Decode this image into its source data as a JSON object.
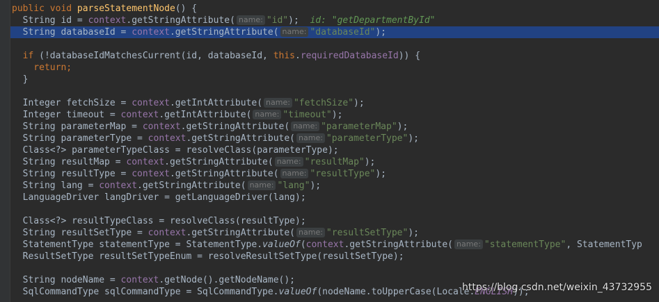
{
  "editor": {
    "lines": [
      {
        "tokens": [
          {
            "t": "public void ",
            "c": "kw"
          },
          {
            "t": "parseStatementNode",
            "c": "fn"
          },
          {
            "t": "() {",
            "c": ""
          }
        ]
      },
      {
        "tokens": [
          {
            "t": "  String id = ",
            "c": ""
          },
          {
            "t": "context",
            "c": "fld"
          },
          {
            "t": ".getStringAttribute(",
            "c": ""
          },
          {
            "t": "name:",
            "c": "hint"
          },
          {
            "t": "\"id\"",
            "c": "str"
          },
          {
            "t": ");  ",
            "c": ""
          },
          {
            "t": "id: \"getDepartmentById\"",
            "c": "inlay-comment"
          }
        ]
      },
      {
        "selected": true,
        "tokens": [
          {
            "t": "  String databaseId = ",
            "c": ""
          },
          {
            "t": "context",
            "c": "fld"
          },
          {
            "t": ".getStringAttribute(",
            "c": ""
          },
          {
            "t": "name:",
            "c": "hint"
          },
          {
            "t": "\"databaseId\"",
            "c": "str"
          },
          {
            "t": ");",
            "c": ""
          }
        ]
      },
      {
        "tokens": []
      },
      {
        "tokens": [
          {
            "t": "  if ",
            "c": "kw"
          },
          {
            "t": "(!databaseIdMatchesCurrent(id, databaseId, ",
            "c": ""
          },
          {
            "t": "this",
            "c": "kw"
          },
          {
            "t": ".",
            "c": ""
          },
          {
            "t": "requiredDatabaseId",
            "c": "fld"
          },
          {
            "t": ")) {",
            "c": ""
          }
        ]
      },
      {
        "tokens": [
          {
            "t": "    return",
            "c": "kw"
          },
          {
            "t": ";",
            "c": "kw"
          }
        ]
      },
      {
        "tokens": [
          {
            "t": "  }",
            "c": ""
          }
        ]
      },
      {
        "tokens": []
      },
      {
        "tokens": [
          {
            "t": "  Integer fetchSize = ",
            "c": ""
          },
          {
            "t": "context",
            "c": "fld"
          },
          {
            "t": ".getIntAttribute(",
            "c": ""
          },
          {
            "t": "name:",
            "c": "hint"
          },
          {
            "t": "\"fetchSize\"",
            "c": "str"
          },
          {
            "t": ");",
            "c": ""
          }
        ]
      },
      {
        "tokens": [
          {
            "t": "  Integer timeout = ",
            "c": ""
          },
          {
            "t": "context",
            "c": "fld"
          },
          {
            "t": ".getIntAttribute(",
            "c": ""
          },
          {
            "t": "name:",
            "c": "hint"
          },
          {
            "t": "\"timeout\"",
            "c": "str"
          },
          {
            "t": ");",
            "c": ""
          }
        ]
      },
      {
        "tokens": [
          {
            "t": "  String parameterMap = ",
            "c": ""
          },
          {
            "t": "context",
            "c": "fld"
          },
          {
            "t": ".getStringAttribute(",
            "c": ""
          },
          {
            "t": "name:",
            "c": "hint"
          },
          {
            "t": "\"parameterMap\"",
            "c": "str"
          },
          {
            "t": ");",
            "c": ""
          }
        ]
      },
      {
        "tokens": [
          {
            "t": "  String parameterType = ",
            "c": ""
          },
          {
            "t": "context",
            "c": "fld"
          },
          {
            "t": ".getStringAttribute(",
            "c": ""
          },
          {
            "t": "name:",
            "c": "hint"
          },
          {
            "t": "\"parameterType\"",
            "c": "str"
          },
          {
            "t": ");",
            "c": ""
          }
        ]
      },
      {
        "tokens": [
          {
            "t": "  Class<?> parameterTypeClass = resolveClass(parameterType);",
            "c": ""
          }
        ]
      },
      {
        "tokens": [
          {
            "t": "  String resultMap = ",
            "c": ""
          },
          {
            "t": "context",
            "c": "fld"
          },
          {
            "t": ".getStringAttribute(",
            "c": ""
          },
          {
            "t": "name:",
            "c": "hint"
          },
          {
            "t": "\"resultMap\"",
            "c": "str"
          },
          {
            "t": ");",
            "c": ""
          }
        ]
      },
      {
        "tokens": [
          {
            "t": "  String resultType = ",
            "c": ""
          },
          {
            "t": "context",
            "c": "fld"
          },
          {
            "t": ".getStringAttribute(",
            "c": ""
          },
          {
            "t": "name:",
            "c": "hint"
          },
          {
            "t": "\"resultType\"",
            "c": "str"
          },
          {
            "t": ");",
            "c": ""
          }
        ]
      },
      {
        "tokens": [
          {
            "t": "  String lang = ",
            "c": ""
          },
          {
            "t": "context",
            "c": "fld"
          },
          {
            "t": ".getStringAttribute(",
            "c": ""
          },
          {
            "t": "name:",
            "c": "hint"
          },
          {
            "t": "\"lang\"",
            "c": "str"
          },
          {
            "t": ");",
            "c": ""
          }
        ]
      },
      {
        "tokens": [
          {
            "t": "  LanguageDriver langDriver = getLanguageDriver(lang);",
            "c": ""
          }
        ]
      },
      {
        "tokens": []
      },
      {
        "tokens": [
          {
            "t": "  Class<?> resultTypeClass = resolveClass(resultType);",
            "c": ""
          }
        ]
      },
      {
        "tokens": [
          {
            "t": "  String resultSetType = ",
            "c": ""
          },
          {
            "t": "context",
            "c": "fld"
          },
          {
            "t": ".getStringAttribute(",
            "c": ""
          },
          {
            "t": "name:",
            "c": "hint"
          },
          {
            "t": "\"resultSetType\"",
            "c": "str"
          },
          {
            "t": ");",
            "c": ""
          }
        ]
      },
      {
        "tokens": [
          {
            "t": "  StatementType statementType = StatementType.",
            "c": ""
          },
          {
            "t": "valueOf",
            "c": "italic"
          },
          {
            "t": "(",
            "c": ""
          },
          {
            "t": "context",
            "c": "fld"
          },
          {
            "t": ".getStringAttribute(",
            "c": ""
          },
          {
            "t": "name:",
            "c": "hint"
          },
          {
            "t": "\"statementType\"",
            "c": "str"
          },
          {
            "t": ", StatementTyp",
            "c": ""
          }
        ]
      },
      {
        "tokens": [
          {
            "t": "  ResultSetType resultSetTypeEnum = resolveResultSetType(resultSetType);",
            "c": ""
          }
        ]
      },
      {
        "tokens": []
      },
      {
        "tokens": [
          {
            "t": "  String nodeName = ",
            "c": ""
          },
          {
            "t": "context",
            "c": "fld"
          },
          {
            "t": ".getNode().getNodeName();",
            "c": ""
          }
        ]
      },
      {
        "tokens": [
          {
            "t": "  SqlCommandType sqlCommandType = SqlCommandType.",
            "c": ""
          },
          {
            "t": "valueOf",
            "c": "italic"
          },
          {
            "t": "(nodeName.toUpperCase(Locale.",
            "c": ""
          },
          {
            "t": "ENGLISH",
            "c": "fld italic"
          },
          {
            "t": "));",
            "c": ""
          }
        ]
      }
    ]
  },
  "watermark": "https://blog.csdn.net/weixin_43732955"
}
